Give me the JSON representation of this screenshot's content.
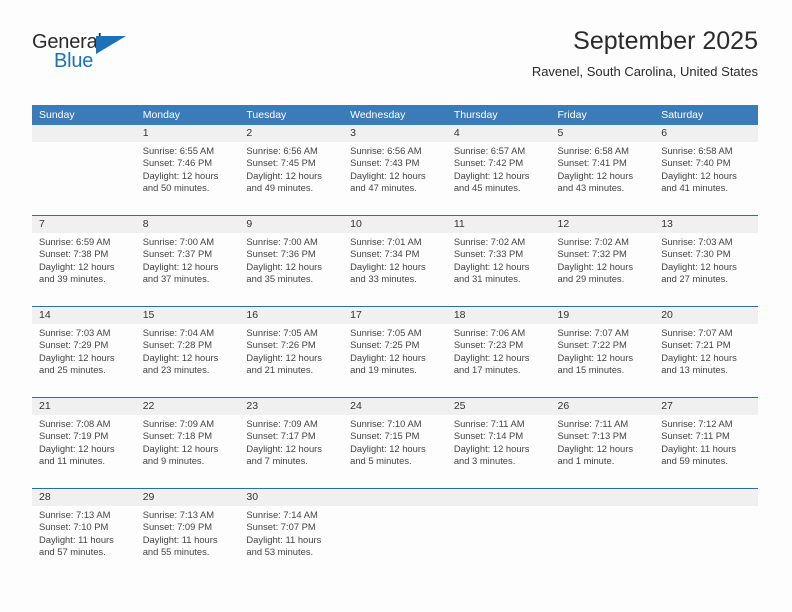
{
  "brand": {
    "name_part1": "General",
    "name_part2": "Blue",
    "accent_color": "#1c71b8",
    "triangle_icon": "triangle-icon"
  },
  "header": {
    "title": "September 2025",
    "subtitle": "Ravenel, South Carolina, United States"
  },
  "calendar": {
    "header_bg": "#3b7cb8",
    "numbers_bg": "#f0f0f0",
    "separator_color": "#2b6caa",
    "day_names": [
      "Sunday",
      "Monday",
      "Tuesday",
      "Wednesday",
      "Thursday",
      "Friday",
      "Saturday"
    ],
    "weeks": [
      [
        {
          "day": "",
          "sunrise": "",
          "sunset": "",
          "daylight": ""
        },
        {
          "day": "1",
          "sunrise": "Sunrise: 6:55 AM",
          "sunset": "Sunset: 7:46 PM",
          "daylight": "Daylight: 12 hours and 50 minutes."
        },
        {
          "day": "2",
          "sunrise": "Sunrise: 6:56 AM",
          "sunset": "Sunset: 7:45 PM",
          "daylight": "Daylight: 12 hours and 49 minutes."
        },
        {
          "day": "3",
          "sunrise": "Sunrise: 6:56 AM",
          "sunset": "Sunset: 7:43 PM",
          "daylight": "Daylight: 12 hours and 47 minutes."
        },
        {
          "day": "4",
          "sunrise": "Sunrise: 6:57 AM",
          "sunset": "Sunset: 7:42 PM",
          "daylight": "Daylight: 12 hours and 45 minutes."
        },
        {
          "day": "5",
          "sunrise": "Sunrise: 6:58 AM",
          "sunset": "Sunset: 7:41 PM",
          "daylight": "Daylight: 12 hours and 43 minutes."
        },
        {
          "day": "6",
          "sunrise": "Sunrise: 6:58 AM",
          "sunset": "Sunset: 7:40 PM",
          "daylight": "Daylight: 12 hours and 41 minutes."
        }
      ],
      [
        {
          "day": "7",
          "sunrise": "Sunrise: 6:59 AM",
          "sunset": "Sunset: 7:38 PM",
          "daylight": "Daylight: 12 hours and 39 minutes."
        },
        {
          "day": "8",
          "sunrise": "Sunrise: 7:00 AM",
          "sunset": "Sunset: 7:37 PM",
          "daylight": "Daylight: 12 hours and 37 minutes."
        },
        {
          "day": "9",
          "sunrise": "Sunrise: 7:00 AM",
          "sunset": "Sunset: 7:36 PM",
          "daylight": "Daylight: 12 hours and 35 minutes."
        },
        {
          "day": "10",
          "sunrise": "Sunrise: 7:01 AM",
          "sunset": "Sunset: 7:34 PM",
          "daylight": "Daylight: 12 hours and 33 minutes."
        },
        {
          "day": "11",
          "sunrise": "Sunrise: 7:02 AM",
          "sunset": "Sunset: 7:33 PM",
          "daylight": "Daylight: 12 hours and 31 minutes."
        },
        {
          "day": "12",
          "sunrise": "Sunrise: 7:02 AM",
          "sunset": "Sunset: 7:32 PM",
          "daylight": "Daylight: 12 hours and 29 minutes."
        },
        {
          "day": "13",
          "sunrise": "Sunrise: 7:03 AM",
          "sunset": "Sunset: 7:30 PM",
          "daylight": "Daylight: 12 hours and 27 minutes."
        }
      ],
      [
        {
          "day": "14",
          "sunrise": "Sunrise: 7:03 AM",
          "sunset": "Sunset: 7:29 PM",
          "daylight": "Daylight: 12 hours and 25 minutes."
        },
        {
          "day": "15",
          "sunrise": "Sunrise: 7:04 AM",
          "sunset": "Sunset: 7:28 PM",
          "daylight": "Daylight: 12 hours and 23 minutes."
        },
        {
          "day": "16",
          "sunrise": "Sunrise: 7:05 AM",
          "sunset": "Sunset: 7:26 PM",
          "daylight": "Daylight: 12 hours and 21 minutes."
        },
        {
          "day": "17",
          "sunrise": "Sunrise: 7:05 AM",
          "sunset": "Sunset: 7:25 PM",
          "daylight": "Daylight: 12 hours and 19 minutes."
        },
        {
          "day": "18",
          "sunrise": "Sunrise: 7:06 AM",
          "sunset": "Sunset: 7:23 PM",
          "daylight": "Daylight: 12 hours and 17 minutes."
        },
        {
          "day": "19",
          "sunrise": "Sunrise: 7:07 AM",
          "sunset": "Sunset: 7:22 PM",
          "daylight": "Daylight: 12 hours and 15 minutes."
        },
        {
          "day": "20",
          "sunrise": "Sunrise: 7:07 AM",
          "sunset": "Sunset: 7:21 PM",
          "daylight": "Daylight: 12 hours and 13 minutes."
        }
      ],
      [
        {
          "day": "21",
          "sunrise": "Sunrise: 7:08 AM",
          "sunset": "Sunset: 7:19 PM",
          "daylight": "Daylight: 12 hours and 11 minutes."
        },
        {
          "day": "22",
          "sunrise": "Sunrise: 7:09 AM",
          "sunset": "Sunset: 7:18 PM",
          "daylight": "Daylight: 12 hours and 9 minutes."
        },
        {
          "day": "23",
          "sunrise": "Sunrise: 7:09 AM",
          "sunset": "Sunset: 7:17 PM",
          "daylight": "Daylight: 12 hours and 7 minutes."
        },
        {
          "day": "24",
          "sunrise": "Sunrise: 7:10 AM",
          "sunset": "Sunset: 7:15 PM",
          "daylight": "Daylight: 12 hours and 5 minutes."
        },
        {
          "day": "25",
          "sunrise": "Sunrise: 7:11 AM",
          "sunset": "Sunset: 7:14 PM",
          "daylight": "Daylight: 12 hours and 3 minutes."
        },
        {
          "day": "26",
          "sunrise": "Sunrise: 7:11 AM",
          "sunset": "Sunset: 7:13 PM",
          "daylight": "Daylight: 12 hours and 1 minute."
        },
        {
          "day": "27",
          "sunrise": "Sunrise: 7:12 AM",
          "sunset": "Sunset: 7:11 PM",
          "daylight": "Daylight: 11 hours and 59 minutes."
        }
      ],
      [
        {
          "day": "28",
          "sunrise": "Sunrise: 7:13 AM",
          "sunset": "Sunset: 7:10 PM",
          "daylight": "Daylight: 11 hours and 57 minutes."
        },
        {
          "day": "29",
          "sunrise": "Sunrise: 7:13 AM",
          "sunset": "Sunset: 7:09 PM",
          "daylight": "Daylight: 11 hours and 55 minutes."
        },
        {
          "day": "30",
          "sunrise": "Sunrise: 7:14 AM",
          "sunset": "Sunset: 7:07 PM",
          "daylight": "Daylight: 11 hours and 53 minutes."
        },
        {
          "day": "",
          "sunrise": "",
          "sunset": "",
          "daylight": ""
        },
        {
          "day": "",
          "sunrise": "",
          "sunset": "",
          "daylight": ""
        },
        {
          "day": "",
          "sunrise": "",
          "sunset": "",
          "daylight": ""
        },
        {
          "day": "",
          "sunrise": "",
          "sunset": "",
          "daylight": ""
        }
      ]
    ]
  }
}
